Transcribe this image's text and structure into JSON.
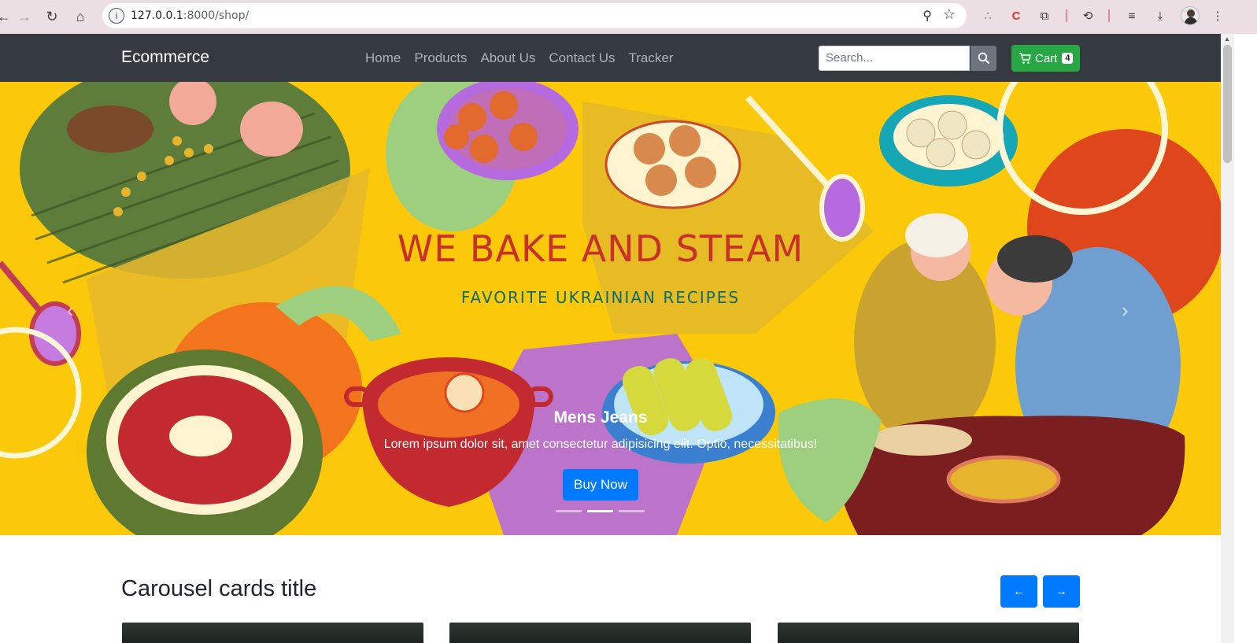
{
  "browser": {
    "url_host": "127.0.0.1",
    "url_rest": ":8000/shop/"
  },
  "navbar": {
    "brand": "Ecommerce",
    "links": [
      "Home",
      "Products",
      "About Us",
      "Contact Us",
      "Tracker"
    ],
    "search_placeholder": "Search...",
    "cart_label": "Cart",
    "cart_count": "4"
  },
  "hero": {
    "banner_title": "WE BAKE AND STEAM",
    "banner_subtitle": "FAVORITE UKRAINIAN RECIPES",
    "caption_title": "Mens Jeans",
    "caption_text": "Lorem ipsum dolor sit, amet consectetur adipisicing elit. Optio, necessitatibus!",
    "button_label": "Buy Now",
    "slides": 3,
    "active_slide": 2,
    "background_color": "#fcc80a"
  },
  "section": {
    "title": "Carousel cards title",
    "prev_icon": "←",
    "next_icon": "→"
  },
  "colors": {
    "navbar": "#343a40",
    "primary": "#007bff",
    "success": "#28a745"
  }
}
